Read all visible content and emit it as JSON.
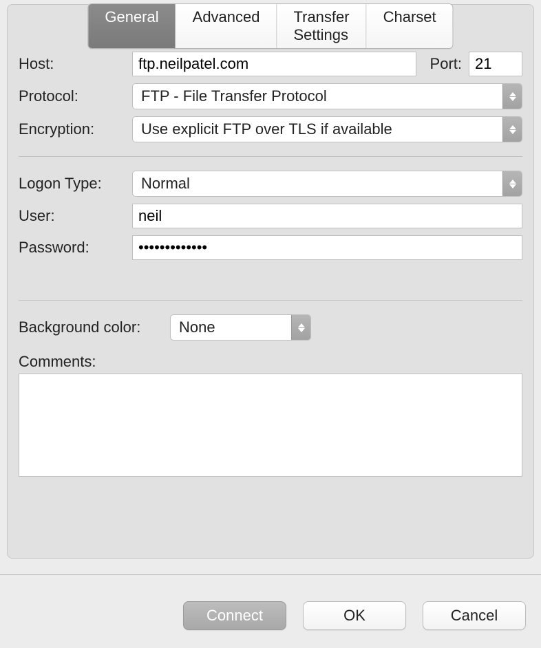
{
  "tabs": {
    "general": "General",
    "advanced": "Advanced",
    "transfer": "Transfer Settings",
    "charset": "Charset"
  },
  "labels": {
    "host": "Host:",
    "port": "Port:",
    "protocol": "Protocol:",
    "encryption": "Encryption:",
    "logon_type": "Logon Type:",
    "user": "User:",
    "password": "Password:",
    "background_color": "Background color:",
    "comments": "Comments:"
  },
  "values": {
    "host": "ftp.neilpatel.com",
    "port": "21",
    "protocol": "FTP - File Transfer Protocol",
    "encryption": "Use explicit FTP over TLS if available",
    "logon_type": "Normal",
    "user": "neil",
    "password": "•••••••••••••",
    "background_color": "None",
    "comments": ""
  },
  "buttons": {
    "connect": "Connect",
    "ok": "OK",
    "cancel": "Cancel"
  }
}
